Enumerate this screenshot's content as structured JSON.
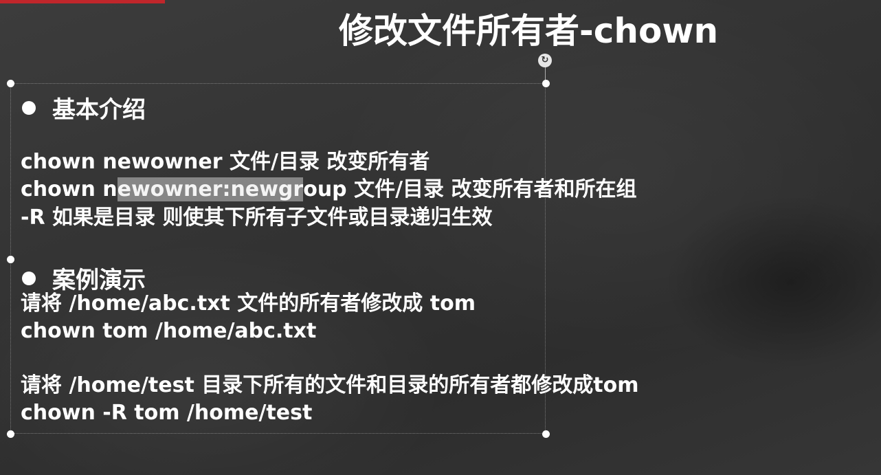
{
  "slide": {
    "title": "修改文件所有者-chown",
    "rotate_icon": "rotate-icon",
    "section1": {
      "heading": "基本介绍",
      "lines": [
        "chown  newowner  文件/目录   改变所有者",
        "-R   如果是目录 则使其下所有子文件或目录递归生效"
      ],
      "line2": {
        "before": "chown n",
        "selected": "ewowner:newgr",
        "after": "oup  文件/目录 改变所有者和所在组"
      }
    },
    "section2": {
      "heading": "案例演示",
      "lines": [
        "请将 /home/abc.txt 文件的所有者修改成 tom",
        "chown tom /home/abc.txt",
        "请将 /home/test 目录下所有的文件和目录的所有者都修改成tom",
        "chown -R tom /home/test"
      ]
    }
  },
  "colors": {
    "background": "#333333",
    "text": "#ffffff",
    "accent_bar": "#c0262b",
    "selection": "#b4b4b4"
  }
}
